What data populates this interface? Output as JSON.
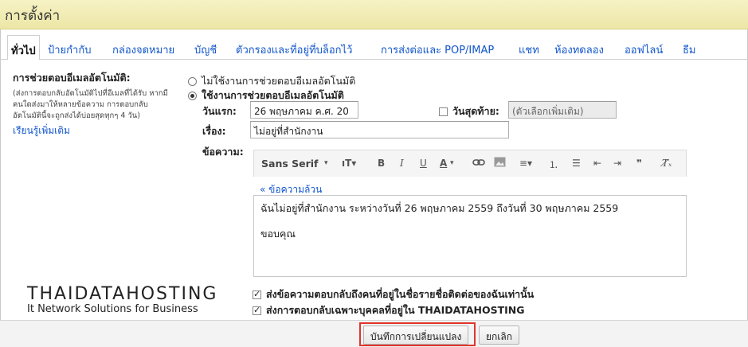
{
  "header": {
    "title": "การตั้งค่า"
  },
  "tabs": [
    {
      "label": "ทั่วไป",
      "active": true
    },
    {
      "label": "ป้ายกำกับ"
    },
    {
      "label": "กล่องจดหมาย"
    },
    {
      "label": "บัญชี"
    },
    {
      "label": "ตัวกรองและที่อยู่ที่บล็อกไว้"
    },
    {
      "label": "การส่งต่อและ POP/IMAP"
    },
    {
      "label": "แชท"
    },
    {
      "label": "ห้องทดลอง"
    },
    {
      "label": "ออฟไลน์"
    },
    {
      "label": "ธีม"
    }
  ],
  "vacation": {
    "title": "การช่วยตอบอีเมลอัตโนมัติ:",
    "description": [
      "(ส่งการตอบกลับอัตโนมัติไปที่อีเมลที่ได้รับ หากมี",
      "คนใดส่งมาให้หลายข้อความ การตอบกลับ",
      "อัตโนมัตินี้จะถูกส่งได้บ่อยสุดทุกๆ 4 วัน)"
    ],
    "learn_more": "เรียนรู้เพิ่มเติม",
    "option_off": "ไม่ใช้งานการช่วยตอบอีเมลอัตโนมัติ",
    "option_on": "ใช้งานการช่วยตอบอีเมลอัตโนมัติ",
    "first_day_label": "วันแรก:",
    "first_day_value": "26 พฤษภาคม ค.ศ. 20",
    "last_day_label": "วันสุดท้าย:",
    "last_day_placeholder": "(ตัวเลือกเพิ่มเติม)",
    "subject_label": "เรื่อง:",
    "subject_value": "ไม่อยู่ที่สำนักงาน",
    "message_label": "ข้อความ:",
    "plain_text_link": "« ข้อความล้วน",
    "message_lines": [
      "ฉันไม่อยู่ที่สำนักงาน ระหว่างวันที่ 26 พฤษภาคม 2559 ถึงวันที่ 30 พฤษภาคม 2559",
      "ขอบคุณ"
    ],
    "contacts_only": "ส่งข้อความตอบกลับถึงคนที่อยู่ในชื่อรายชื่อติดต่อของฉันเท่านั้น",
    "domain_only": "ส่งการตอบกลับเฉพาะบุคคลที่อยู่ใน THAIDATAHOSTING"
  },
  "toolbar": {
    "font": "Sans Serif",
    "size_icon": "text-size-icon",
    "bold": "B",
    "italic": "I",
    "underline": "U",
    "color": "A"
  },
  "logo": {
    "main": "THAIDATAHOSTING",
    "sub": "It Network Solutions for Business"
  },
  "footer": {
    "save": "บันทึกการเปลี่ยนแปลง",
    "cancel": "ยกเลิก"
  },
  "colors": {
    "link": "#1155cc",
    "header_bg": "#f1ecb6",
    "highlight": "#e0352b"
  }
}
